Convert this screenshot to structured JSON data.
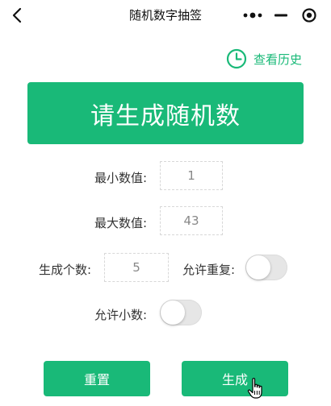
{
  "navbar": {
    "title": "随机数字抽签",
    "back_icon": "chevron-left-icon",
    "more_icon": "more-dots-icon",
    "minimize_icon": "minimize-icon",
    "close_icon": "target-close-icon"
  },
  "history": {
    "label": "查看历史",
    "icon": "clock-icon"
  },
  "result": {
    "text": "请生成随机数"
  },
  "form": {
    "min_label": "最小数值:",
    "min_value": "1",
    "max_label": "最大数值:",
    "max_value": "43",
    "count_label": "生成个数:",
    "count_value": "5",
    "allow_repeat_label": "允许重复:",
    "allow_repeat": false,
    "allow_decimal_label": "允许小数:",
    "allow_decimal": false
  },
  "buttons": {
    "reset_label": "重置",
    "generate_label": "生成"
  },
  "colors": {
    "accent": "#19b978",
    "switch_off": "#e6e6e6"
  }
}
